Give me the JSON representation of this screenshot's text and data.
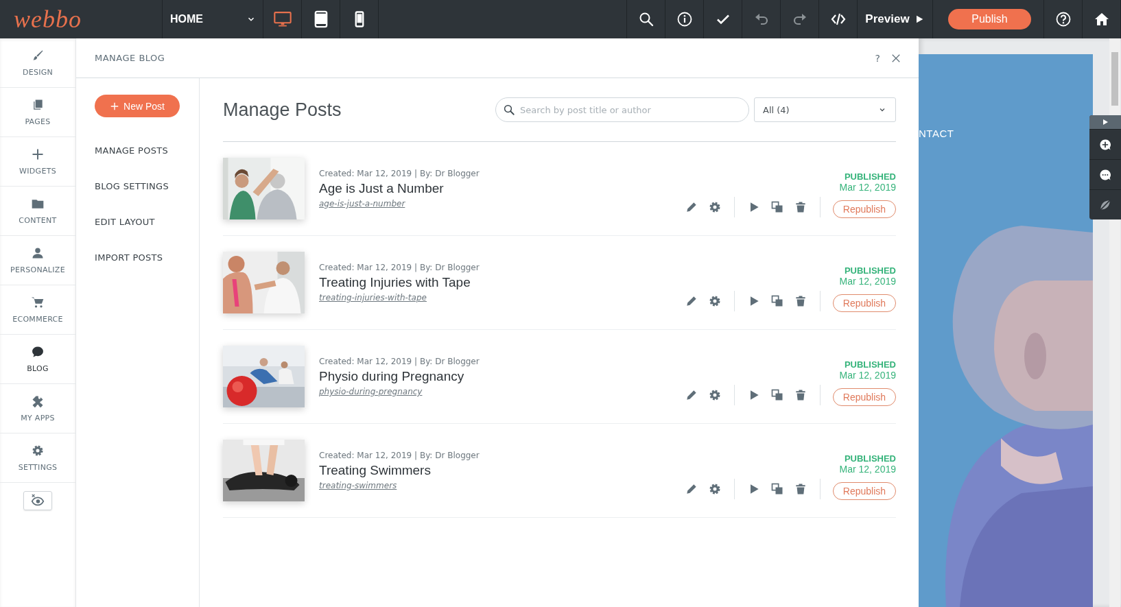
{
  "topbar": {
    "logo": "webbo",
    "page_select": "HOME",
    "devices": [
      {
        "kind": "desktop",
        "selected": true
      },
      {
        "kind": "tablet",
        "selected": false
      },
      {
        "kind": "phone",
        "selected": false
      }
    ],
    "tools": [
      {
        "kind": "search",
        "disabled": false
      },
      {
        "kind": "info",
        "disabled": false
      },
      {
        "kind": "check",
        "disabled": false
      },
      {
        "kind": "undo",
        "disabled": true
      },
      {
        "kind": "redo",
        "disabled": true
      },
      {
        "kind": "code",
        "disabled": false
      }
    ],
    "preview": "Preview",
    "publish": "Publish",
    "end_tools": [
      {
        "kind": "help"
      },
      {
        "kind": "home"
      }
    ]
  },
  "rail": {
    "items": [
      {
        "kind": "design",
        "label": "DESIGN",
        "selected": false
      },
      {
        "kind": "pages",
        "label": "PAGES",
        "selected": false
      },
      {
        "kind": "widgets",
        "label": "WIDGETS",
        "selected": false
      },
      {
        "kind": "content",
        "label": "CONTENT",
        "selected": false
      },
      {
        "kind": "personalize",
        "label": "PERSONALIZE",
        "selected": false
      },
      {
        "kind": "ecommerce",
        "label": "ECOMMERCE",
        "selected": false
      },
      {
        "kind": "blog",
        "label": "BLOG",
        "selected": true
      },
      {
        "kind": "apps",
        "label": "MY APPS",
        "selected": false
      },
      {
        "kind": "settings",
        "label": "SETTINGS",
        "selected": false
      }
    ]
  },
  "panel": {
    "title": "MANAGE BLOG",
    "help": "?"
  },
  "submenu": {
    "new_post": "New Post",
    "items": [
      "MANAGE POSTS",
      "BLOG SETTINGS",
      "EDIT LAYOUT",
      "IMPORT POSTS"
    ]
  },
  "posts": {
    "heading": "Manage Posts",
    "search": {
      "placeholder": "Search by post title or author"
    },
    "filter": "All (4)",
    "rows": [
      {
        "meta": "Created: Mar 12, 2019 | By: Dr Blogger",
        "title": "Age is Just a Number",
        "slug": "age-is-just-a-number",
        "status": "PUBLISHED",
        "date": "Mar 12, 2019",
        "action": "Republish"
      },
      {
        "meta": "Created: Mar 12, 2019 | By: Dr Blogger",
        "title": "Treating Injuries with Tape",
        "slug": "treating-injuries-with-tape",
        "status": "PUBLISHED",
        "date": "Mar 12, 2019",
        "action": "Republish"
      },
      {
        "meta": "Created: Mar 12, 2019 | By: Dr Blogger",
        "title": "Physio during Pregnancy",
        "slug": "physio-during-pregnancy",
        "status": "PUBLISHED",
        "date": "Mar 12, 2019",
        "action": "Republish"
      },
      {
        "meta": "Created: Mar 12, 2019 | By: Dr Blogger",
        "title": "Treating Swimmers",
        "slug": "treating-swimmers",
        "status": "PUBLISHED",
        "date": "Mar 12, 2019",
        "action": "Republish"
      }
    ]
  },
  "preview": {
    "nav_text": "NTACT"
  }
}
